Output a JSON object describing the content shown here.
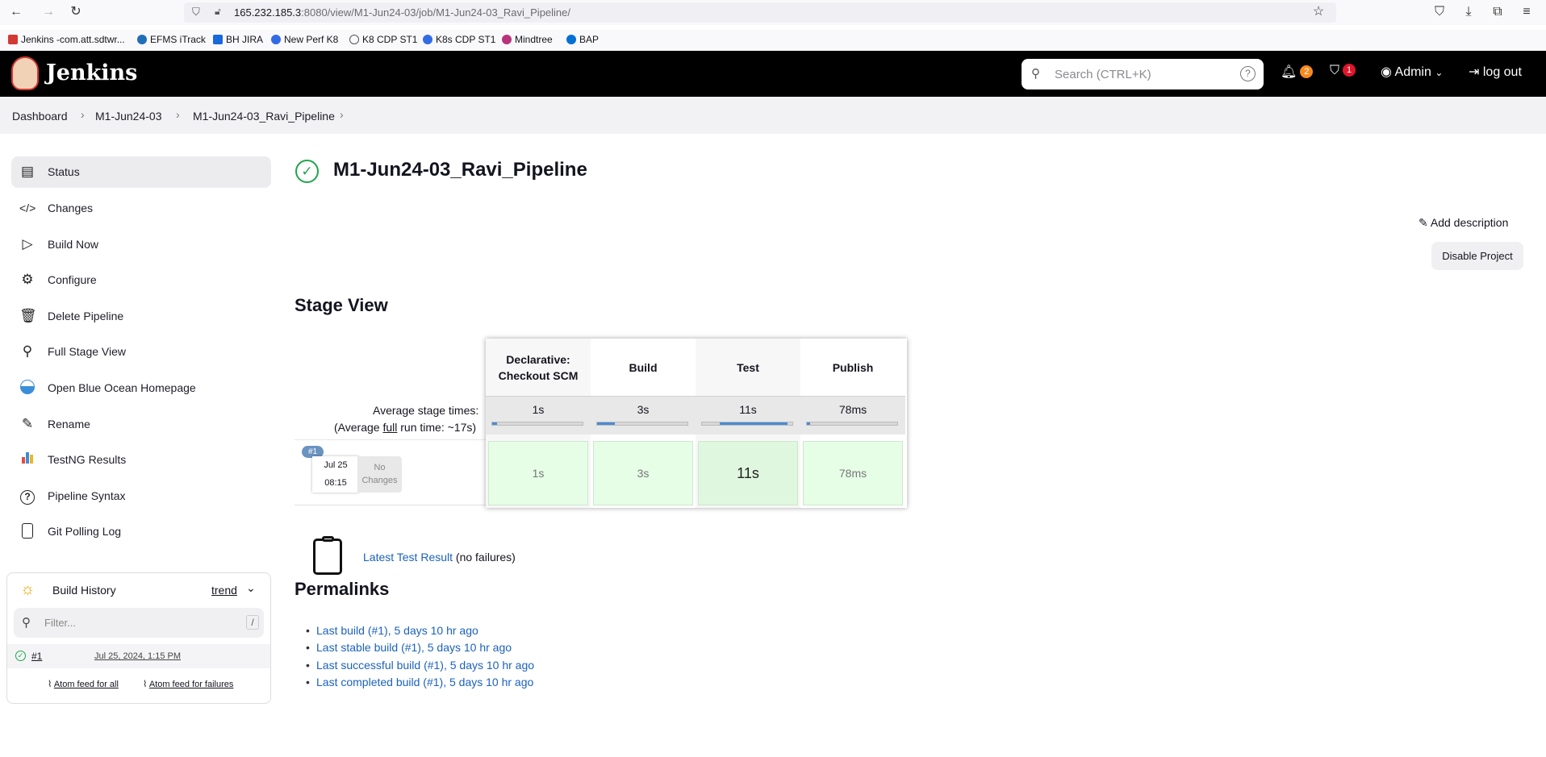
{
  "browser": {
    "url_host": "165.232.185.3",
    "url_rest": ":8080/view/M1-Jun24-03/job/M1-Jun24-03_Ravi_Pipeline/",
    "bookmarks": [
      "Jenkins -com.att.sdtwr...",
      "EFMS iTrack",
      "BH JIRA",
      "New Perf K8",
      "K8 CDP ST1",
      "K8s CDP ST1",
      "Mindtree",
      "BAP"
    ]
  },
  "header": {
    "logo": "Jenkins",
    "search_placeholder": "Search (CTRL+K)",
    "help": "?",
    "notifications_count": "2",
    "security_count": "1",
    "user": "Admin",
    "logout": "log out"
  },
  "breadcrumb": [
    "Dashboard",
    "M1-Jun24-03",
    "M1-Jun24-03_Ravi_Pipeline"
  ],
  "sidebar": {
    "items": [
      {
        "label": "Status",
        "icon": "document-icon"
      },
      {
        "label": "Changes",
        "icon": "code-icon"
      },
      {
        "label": "Build Now",
        "icon": "play-icon"
      },
      {
        "label": "Configure",
        "icon": "gear-icon"
      },
      {
        "label": "Delete Pipeline",
        "icon": "trash-icon"
      },
      {
        "label": "Full Stage View",
        "icon": "search-icon"
      },
      {
        "label": "Open Blue Ocean Homepage",
        "icon": "blue-ocean-icon"
      },
      {
        "label": "Rename",
        "icon": "pencil-icon"
      },
      {
        "label": "TestNG Results",
        "icon": "chart-icon"
      },
      {
        "label": "Pipeline Syntax",
        "icon": "help-icon"
      },
      {
        "label": "Git Polling Log",
        "icon": "clipboard-icon"
      }
    ]
  },
  "build_history": {
    "title": "Build History",
    "trend": "trend",
    "filter_placeholder": "Filter...",
    "filter_shortcut": "/",
    "builds": [
      {
        "number": "#1",
        "date": "Jul 25, 2024, 1:15 PM"
      }
    ],
    "feed_all": "Atom feed for all",
    "feed_failures": "Atom feed for failures"
  },
  "main": {
    "title": "M1-Jun24-03_Ravi_Pipeline",
    "add_description": "Add description",
    "disable_project": "Disable Project",
    "stage_view_title": "Stage View",
    "avg_label": "Average stage times:",
    "avg_full_prefix": "(Average ",
    "avg_full_link": "full",
    "avg_full_suffix": " run time: ~17s)",
    "run": {
      "badge": "#1",
      "date": "Jul 25",
      "time": "08:15",
      "changes": "No Changes"
    },
    "stages": [
      {
        "name": "Declarative: Checkout SCM",
        "avg": "1s",
        "progress": 0.05,
        "cell": "1s"
      },
      {
        "name": "Build",
        "avg": "3s",
        "progress": 0.2,
        "cell": "3s"
      },
      {
        "name": "Test",
        "avg": "11s",
        "progress": 0.75,
        "cell": "11s"
      },
      {
        "name": "Publish",
        "avg": "78ms",
        "progress": 0.01,
        "cell": "78ms"
      }
    ],
    "latest_test_link": "Latest Test Result",
    "latest_test_note": "(no failures)",
    "permalinks_title": "Permalinks",
    "permalinks": [
      "Last build (#1), 5 days 10 hr ago",
      "Last stable build (#1), 5 days 10 hr ago",
      "Last successful build (#1), 5 days 10 hr ago",
      "Last completed build (#1), 5 days 10 hr ago"
    ]
  },
  "colors": {
    "success": "#1ea64b",
    "link": "#1b62bd",
    "header": "#000000",
    "stage_success": "#e6fde6"
  }
}
